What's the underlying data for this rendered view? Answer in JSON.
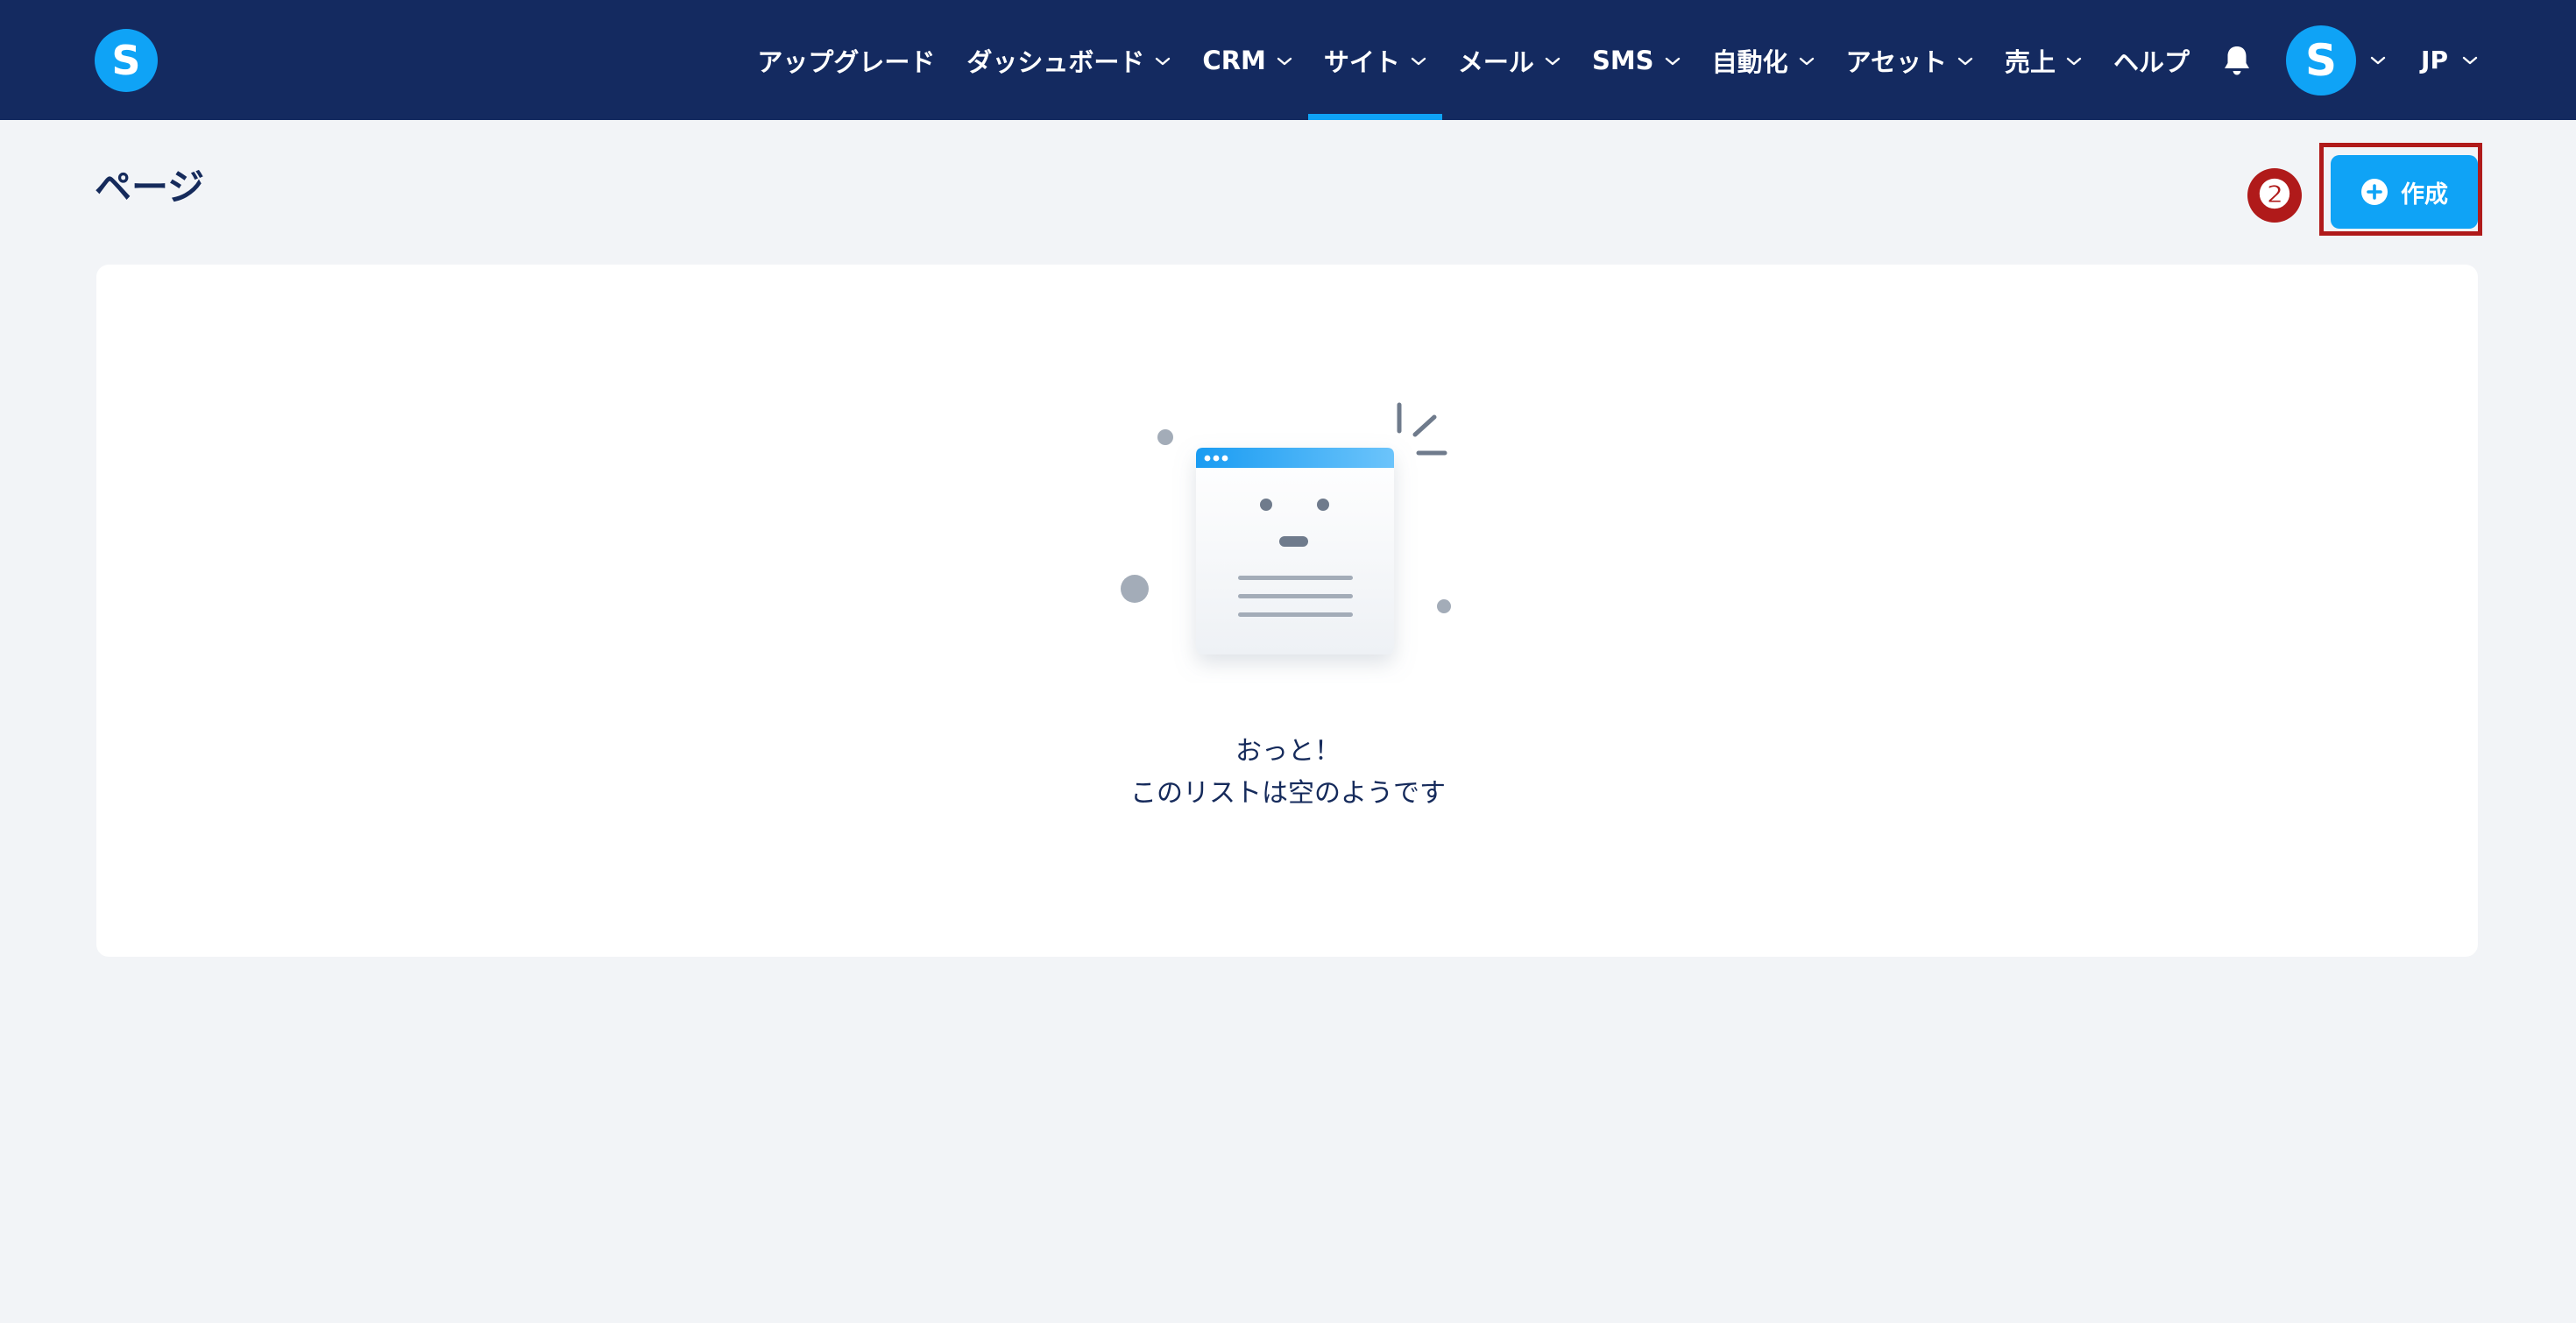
{
  "app": {
    "logo_letter": "S",
    "brand_color": "#0fa3f6",
    "nav_color": "#142a60"
  },
  "nav": {
    "items": [
      {
        "label": "アップグレード",
        "has_dropdown": false,
        "active": false
      },
      {
        "label": "ダッシュボード",
        "has_dropdown": true,
        "active": false
      },
      {
        "label": "CRM",
        "has_dropdown": true,
        "active": false
      },
      {
        "label": "サイト",
        "has_dropdown": true,
        "active": true
      },
      {
        "label": "メール",
        "has_dropdown": true,
        "active": false
      },
      {
        "label": "SMS",
        "has_dropdown": true,
        "active": false
      },
      {
        "label": "自動化",
        "has_dropdown": true,
        "active": false
      },
      {
        "label": "アセット",
        "has_dropdown": true,
        "active": false
      },
      {
        "label": "売上",
        "has_dropdown": true,
        "active": false
      },
      {
        "label": "ヘルプ",
        "has_dropdown": false,
        "active": false
      }
    ],
    "bell_icon": "bell-icon",
    "avatar_letter": "S",
    "language": "JP"
  },
  "page": {
    "title": "ページ",
    "step_marker": "❷",
    "step_color": "#b01a1a",
    "create_button": {
      "label": "作成",
      "icon": "plus-circle-icon"
    }
  },
  "empty_state": {
    "line1": "おっと！",
    "line2": "このリストは空のようです",
    "illustration_icon": "empty-page-icon"
  }
}
